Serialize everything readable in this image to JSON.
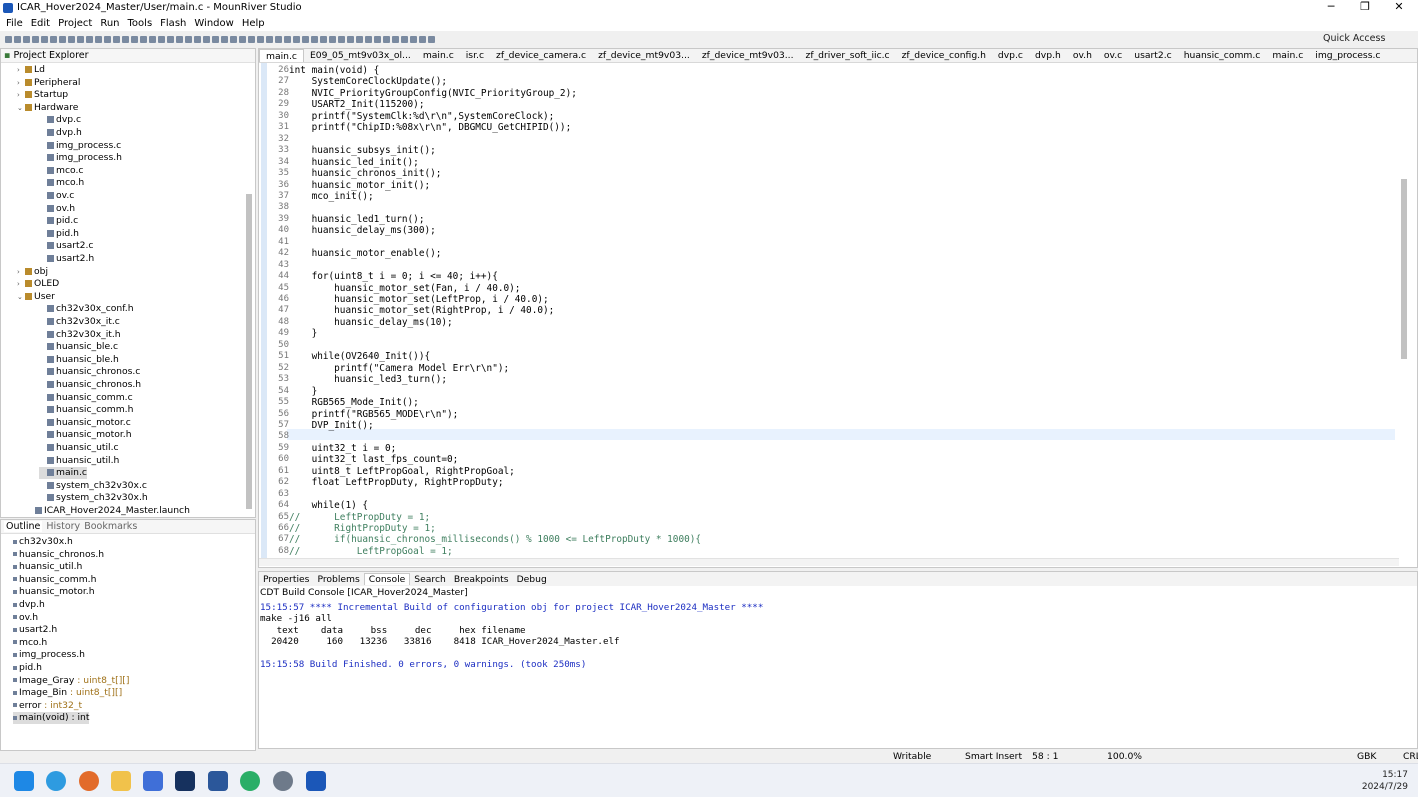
{
  "window": {
    "title": "ICAR_Hover2024_Master/User/main.c - MounRiver Studio",
    "minimize": "─",
    "maximize": "❐",
    "close": "✕"
  },
  "menu": [
    "File",
    "Edit",
    "Project",
    "Run",
    "Tools",
    "Flash",
    "Window",
    "Help"
  ],
  "quick_access": "Quick Access",
  "project_explorer": {
    "title": "Project Explorer",
    "items": [
      {
        "label": "Ld",
        "twisty": "›",
        "folder": true
      },
      {
        "label": "Peripheral",
        "twisty": "›",
        "folder": true
      },
      {
        "label": "Startup",
        "twisty": "›",
        "folder": true
      },
      {
        "label": "Hardware",
        "twisty": "⌄",
        "folder": true
      },
      {
        "label": "dvp.c",
        "twisty": "",
        "folder": false
      },
      {
        "label": "dvp.h",
        "twisty": "",
        "folder": false
      },
      {
        "label": "img_process.c",
        "twisty": "",
        "folder": false
      },
      {
        "label": "img_process.h",
        "twisty": "",
        "folder": false
      },
      {
        "label": "mco.c",
        "twisty": "",
        "folder": false
      },
      {
        "label": "mco.h",
        "twisty": "",
        "folder": false
      },
      {
        "label": "ov.c",
        "twisty": "",
        "folder": false
      },
      {
        "label": "ov.h",
        "twisty": "",
        "folder": false
      },
      {
        "label": "pid.c",
        "twisty": "",
        "folder": false
      },
      {
        "label": "pid.h",
        "twisty": "",
        "folder": false
      },
      {
        "label": "usart2.c",
        "twisty": "",
        "folder": false
      },
      {
        "label": "usart2.h",
        "twisty": "",
        "folder": false
      },
      {
        "label": "obj",
        "twisty": "›",
        "folder": true
      },
      {
        "label": "OLED",
        "twisty": "›",
        "folder": true
      },
      {
        "label": "User",
        "twisty": "⌄",
        "folder": true
      },
      {
        "label": "ch32v30x_conf.h",
        "twisty": "",
        "folder": false
      },
      {
        "label": "ch32v30x_it.c",
        "twisty": "",
        "folder": false
      },
      {
        "label": "ch32v30x_it.h",
        "twisty": "",
        "folder": false
      },
      {
        "label": "huansic_ble.c",
        "twisty": "",
        "folder": false
      },
      {
        "label": "huansic_ble.h",
        "twisty": "",
        "folder": false
      },
      {
        "label": "huansic_chronos.c",
        "twisty": "",
        "folder": false
      },
      {
        "label": "huansic_chronos.h",
        "twisty": "",
        "folder": false
      },
      {
        "label": "huansic_comm.c",
        "twisty": "",
        "folder": false
      },
      {
        "label": "huansic_comm.h",
        "twisty": "",
        "folder": false
      },
      {
        "label": "huansic_motor.c",
        "twisty": "",
        "folder": false
      },
      {
        "label": "huansic_motor.h",
        "twisty": "",
        "folder": false
      },
      {
        "label": "huansic_util.c",
        "twisty": "",
        "folder": false
      },
      {
        "label": "huansic_util.h",
        "twisty": "",
        "folder": false
      },
      {
        "label": "main.c",
        "twisty": "",
        "folder": false
      },
      {
        "label": "system_ch32v30x.c",
        "twisty": "",
        "folder": false
      },
      {
        "label": "system_ch32v30x.h",
        "twisty": "",
        "folder": false
      },
      {
        "label": "ICAR_Hover2024_Master.launch",
        "twisty": "",
        "folder": false
      }
    ]
  },
  "outline": {
    "tabs": [
      "Outline",
      "History",
      "Bookmarks"
    ],
    "items": [
      {
        "name": "ch32v30x.h",
        "type": ""
      },
      {
        "name": "huansic_chronos.h",
        "type": ""
      },
      {
        "name": "huansic_util.h",
        "type": ""
      },
      {
        "name": "huansic_comm.h",
        "type": ""
      },
      {
        "name": "huansic_motor.h",
        "type": ""
      },
      {
        "name": "dvp.h",
        "type": ""
      },
      {
        "name": "ov.h",
        "type": ""
      },
      {
        "name": "usart2.h",
        "type": ""
      },
      {
        "name": "mco.h",
        "type": ""
      },
      {
        "name": "img_process.h",
        "type": ""
      },
      {
        "name": "pid.h",
        "type": ""
      },
      {
        "name": "Image_Gray",
        "type": " : uint8_t[][]"
      },
      {
        "name": "Image_Bin",
        "type": " : uint8_t[][]"
      },
      {
        "name": "error",
        "type": " : int32_t"
      },
      {
        "name": "main(void) : int",
        "type": ""
      }
    ]
  },
  "editor_tabs": [
    "main.c",
    "E09_05_mt9v03x_ol...",
    "main.c",
    "isr.c",
    "zf_device_camera.c",
    "zf_device_mt9v03...",
    "zf_device_mt9v03...",
    "zf_driver_soft_iic.c",
    "zf_device_config.h",
    "dvp.c",
    "dvp.h",
    "ov.h",
    "ov.c",
    "usart2.c",
    "huansic_comm.c",
    "main.c",
    "img_process.c"
  ],
  "code": [
    {
      "n": "26",
      "t": "int main(void) {"
    },
    {
      "n": "27",
      "t": "    SystemCoreClockUpdate();"
    },
    {
      "n": "28",
      "t": "    NVIC_PriorityGroupConfig(NVIC_PriorityGroup_2);"
    },
    {
      "n": "29",
      "t": "    USART2_Init(115200);"
    },
    {
      "n": "30",
      "t": "    printf(\"SystemClk:%d\\r\\n\",SystemCoreClock);"
    },
    {
      "n": "31",
      "t": "    printf(\"ChipID:%08x\\r\\n\", DBGMCU_GetCHIPID());"
    },
    {
      "n": "32",
      "t": ""
    },
    {
      "n": "33",
      "t": "    huansic_subsys_init();"
    },
    {
      "n": "34",
      "t": "    huansic_led_init();"
    },
    {
      "n": "35",
      "t": "    huansic_chronos_init();"
    },
    {
      "n": "36",
      "t": "    huansic_motor_init();"
    },
    {
      "n": "37",
      "t": "    mco_init();"
    },
    {
      "n": "38",
      "t": ""
    },
    {
      "n": "39",
      "t": "    huansic_led1_turn();"
    },
    {
      "n": "40",
      "t": "    huansic_delay_ms(300);"
    },
    {
      "n": "41",
      "t": ""
    },
    {
      "n": "42",
      "t": "    huansic_motor_enable();"
    },
    {
      "n": "43",
      "t": ""
    },
    {
      "n": "44",
      "t": "    for(uint8_t i = 0; i <= 40; i++){"
    },
    {
      "n": "45",
      "t": "        huansic_motor_set(Fan, i / 40.0);"
    },
    {
      "n": "46",
      "t": "        huansic_motor_set(LeftProp, i / 40.0);"
    },
    {
      "n": "47",
      "t": "        huansic_motor_set(RightProp, i / 40.0);"
    },
    {
      "n": "48",
      "t": "        huansic_delay_ms(10);"
    },
    {
      "n": "49",
      "t": "    }"
    },
    {
      "n": "50",
      "t": ""
    },
    {
      "n": "51",
      "t": "    while(OV2640_Init()){"
    },
    {
      "n": "52",
      "t": "        printf(\"Camera Model Err\\r\\n\");"
    },
    {
      "n": "53",
      "t": "        huansic_led3_turn();"
    },
    {
      "n": "54",
      "t": "    }"
    },
    {
      "n": "55",
      "t": "    RGB565_Mode_Init();"
    },
    {
      "n": "56",
      "t": "    printf(\"RGB565_MODE\\r\\n\");"
    },
    {
      "n": "57",
      "t": "    DVP_Init();"
    },
    {
      "n": "58",
      "t": ""
    },
    {
      "n": "59",
      "t": "    uint32_t i = 0;"
    },
    {
      "n": "60",
      "t": "    uint32_t last_fps_count=0;"
    },
    {
      "n": "61",
      "t": "    uint8_t LeftPropGoal, RightPropGoal;"
    },
    {
      "n": "62",
      "t": "    float LeftPropDuty, RightPropDuty;"
    },
    {
      "n": "63",
      "t": ""
    },
    {
      "n": "64",
      "t": "    while(1) {"
    },
    {
      "n": "65",
      "t": "//      LeftPropDuty = 1;"
    },
    {
      "n": "66",
      "t": "//      RightPropDuty = 1;"
    },
    {
      "n": "67",
      "t": "//      if(huansic_chronos_milliseconds() % 1000 <= LeftPropDuty * 1000){"
    },
    {
      "n": "68",
      "t": "//          LeftPropGoal = 1;"
    }
  ],
  "console": {
    "tabs": [
      "Properties",
      "Problems",
      "Console",
      "Search",
      "Breakpoints",
      "Debug"
    ],
    "header": "CDT Build Console [ICAR_Hover2024_Master]",
    "lines": [
      {
        "t": "15:15:57 **** Incremental Build of configuration obj for project ICAR_Hover2024_Master ****",
        "c": "#1c2ec2"
      },
      {
        "t": "make -j16 all",
        "c": "#000"
      },
      {
        "t": "   text    data     bss     dec     hex filename",
        "c": "#000"
      },
      {
        "t": "  20420     160   13236   33816    8418 ICAR_Hover2024_Master.elf",
        "c": "#000"
      },
      {
        "t": "",
        "c": "#000"
      },
      {
        "t": "15:15:58 Build Finished. 0 errors, 0 warnings. (took 250ms)",
        "c": "#1c2ec2"
      }
    ]
  },
  "status": {
    "writable": "Writable",
    "insert": "Smart Insert",
    "position": "58 : 1",
    "zoom": "100.0%",
    "encoding": "GBK",
    "line_end": "CRL"
  },
  "taskbar": {
    "time": "15:17",
    "date": "2024/7/29"
  }
}
